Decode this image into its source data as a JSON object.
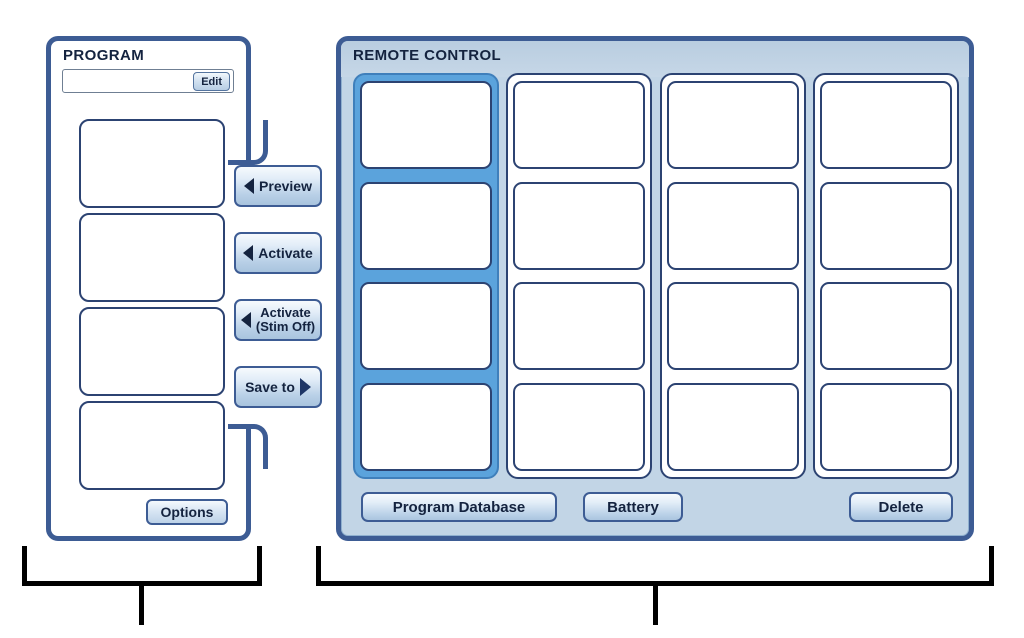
{
  "program_panel": {
    "title": "PROGRAM",
    "field": {
      "value": "",
      "placeholder": ""
    },
    "edit_label": "Edit",
    "slots": [
      {
        "label": ""
      },
      {
        "label": ""
      },
      {
        "label": ""
      },
      {
        "label": ""
      }
    ],
    "options_label": "Options"
  },
  "button_strip": {
    "preview_label": "Preview",
    "activate_label": "Activate",
    "activate_stim_off_line1": "Activate",
    "activate_stim_off_line2": "(Stim Off)",
    "save_to_label": "Save to"
  },
  "remote_panel": {
    "title": "REMOTE CONTROL",
    "columns": [
      {
        "selected": true,
        "cells": [
          "",
          "",
          "",
          ""
        ]
      },
      {
        "selected": false,
        "cells": [
          "",
          "",
          "",
          ""
        ]
      },
      {
        "selected": false,
        "cells": [
          "",
          "",
          "",
          ""
        ]
      },
      {
        "selected": false,
        "cells": [
          "",
          "",
          "",
          ""
        ]
      }
    ],
    "bottom_bar": {
      "program_database_label": "Program Database",
      "battery_label": "Battery",
      "delete_label": "Delete"
    }
  },
  "callouts": {
    "left_bracket_label": "",
    "right_bracket_label": ""
  },
  "colors": {
    "frame_border": "#3d5c94",
    "panel_background": "#c2d5e6",
    "selected_column": "#5ba3dc",
    "cell_border": "#2c4372",
    "text": "#14233f",
    "bracket": "#000000"
  }
}
